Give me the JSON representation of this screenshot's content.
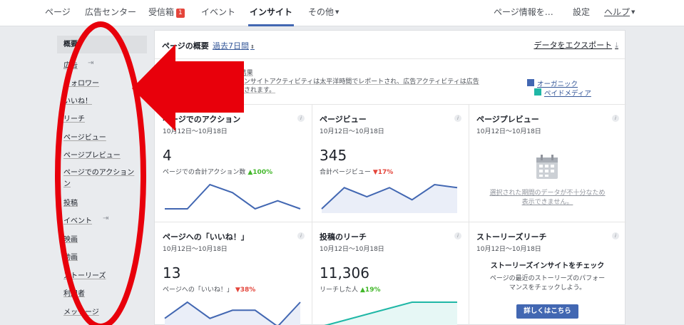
{
  "nav": {
    "items": [
      {
        "label": "ページ"
      },
      {
        "label": "広告センター"
      },
      {
        "label": "受信箱",
        "badge": "1"
      },
      {
        "label": "イベント"
      },
      {
        "label": "インサイト"
      },
      {
        "label": "その他"
      },
      {
        "label": "ページ情報を…"
      },
      {
        "label": "設定"
      },
      {
        "label": "ヘルプ"
      }
    ]
  },
  "sidebar": {
    "items": [
      {
        "label": "概要"
      },
      {
        "label": "広告"
      },
      {
        "label": "フォロワー"
      },
      {
        "label": "いいね！"
      },
      {
        "label": "リーチ"
      },
      {
        "label": "ページビュー"
      },
      {
        "label": "ページプレビュー"
      },
      {
        "label": "ページでのアクション",
        "label2": "ン"
      },
      {
        "label": "投稿"
      },
      {
        "label": "イベント"
      },
      {
        "label": "映画"
      },
      {
        "label": "動画"
      },
      {
        "label": "ストーリーズ"
      },
      {
        "label": "利用者"
      },
      {
        "label": "メッセージ"
      }
    ]
  },
  "main": {
    "title": "ページの概要",
    "period": "過去7日間",
    "export": "データをエクスポート",
    "notice_line1": "0/10/18の結果",
    "notice_line2": "は含まれません。インサイトアクティビティは太平洋時間でレポートされ、広告アクティビティは広告",
    "notice_line3": "の時間帯でレポートされます。",
    "legend": [
      {
        "label": "オーガニック",
        "color": "#4267b2"
      },
      {
        "label": "ペイドメディア",
        "color": "#1fb7a6"
      }
    ]
  },
  "cards": [
    {
      "title": "ページでのアクション",
      "date": "10月12日～10月18日",
      "value": "4",
      "sub": "ページでの合計アクション数",
      "change": "▲100%",
      "trend": "up",
      "series": [
        0,
        0,
        3,
        2,
        0,
        1,
        0
      ],
      "fill": false
    },
    {
      "title": "ページビュー",
      "date": "10月12日～10月18日",
      "value": "345",
      "sub": "合計ページビュー",
      "change": "▼17%",
      "trend": "down",
      "series": [
        2,
        9,
        6,
        9,
        5,
        10,
        9
      ],
      "fill": true
    },
    {
      "title": "ページプレビュー",
      "date": "10月12日～10月18日",
      "nodata1": "選択された期間のデータが不十分なため",
      "nodata2": "表示できません。"
    },
    {
      "title": "ページへの「いいね！」",
      "date": "10月12日～10月18日",
      "value": "13",
      "sub": "ページへの「いいね！」",
      "change": "▼38%",
      "trend": "down",
      "series": [
        1,
        3,
        1,
        2,
        2,
        0,
        3
      ],
      "fill": true
    },
    {
      "title": "投稿のリーチ",
      "date": "10月12日～10月18日",
      "value": "11,306",
      "sub": "リーチした人",
      "change": "▲19%",
      "trend": "up",
      "series": [
        1,
        2,
        3,
        4,
        5,
        5,
        5
      ],
      "fill": true
    },
    {
      "title": "ストーリーズリーチ",
      "date": "10月12日～10月18日",
      "story_head": "ストーリーズインサイトをチェック",
      "story_desc1": "ページの最近のストーリーズのパフォー",
      "story_desc2": "マンスをチェックしよう。",
      "button": "詳しくはこちら"
    }
  ],
  "colors": {
    "accent": "#4267b2",
    "annotation": "#e8000b",
    "paid": "#1fb7a6"
  }
}
